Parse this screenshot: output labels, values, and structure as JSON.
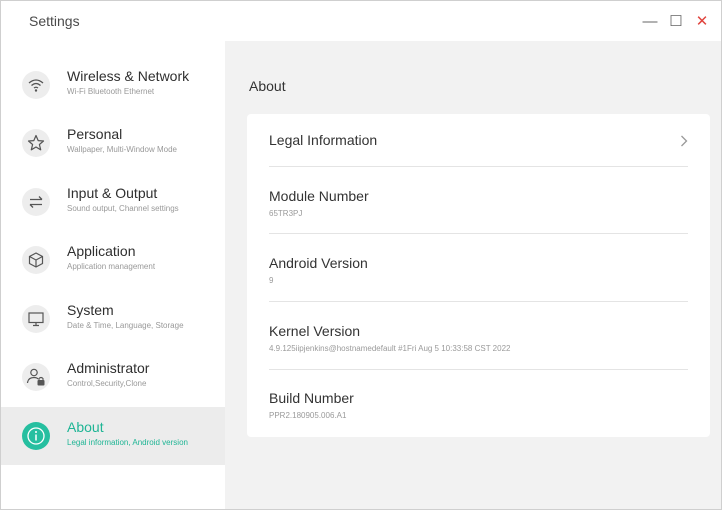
{
  "window": {
    "title": "Settings",
    "minimize_icon": "—",
    "maximize_icon": "☐",
    "close_icon": "✕"
  },
  "sidebar": {
    "items": [
      {
        "label": "Wireless & Network",
        "sub": "Wi-Fi Bluetooth Ethernet",
        "icon": "wifi-icon"
      },
      {
        "label": "Personal",
        "sub": "Wallpaper, Multi-Window Mode",
        "icon": "star-icon"
      },
      {
        "label": "Input & Output",
        "sub": "Sound output, Channel settings",
        "icon": "swap-arrows-icon"
      },
      {
        "label": "Application",
        "sub": "Application management",
        "icon": "cube-icon"
      },
      {
        "label": "System",
        "sub": "Date & Time, Language, Storage",
        "icon": "monitor-icon"
      },
      {
        "label": "Administrator",
        "sub": "Control,Security,Clone",
        "icon": "admin-user-lock-icon"
      },
      {
        "label": "About",
        "sub": "Legal information, Android version",
        "icon": "info-icon",
        "active": true
      }
    ]
  },
  "main": {
    "title": "About",
    "rows": [
      {
        "label": "Legal Information",
        "value": ""
      },
      {
        "label": "Module Number",
        "value": "65TR3PJ"
      },
      {
        "label": "Android Version",
        "value": "9"
      },
      {
        "label": "Kernel Version",
        "value": "4.9.125iipjenkins@hostnamedefault #1Fri Aug 5 10:33:58 CST 2022"
      },
      {
        "label": "Build Number",
        "value": "PPR2.180905.006.A1"
      }
    ]
  },
  "colors": {
    "accent": "#26bfa0",
    "close": "#e0443e"
  }
}
